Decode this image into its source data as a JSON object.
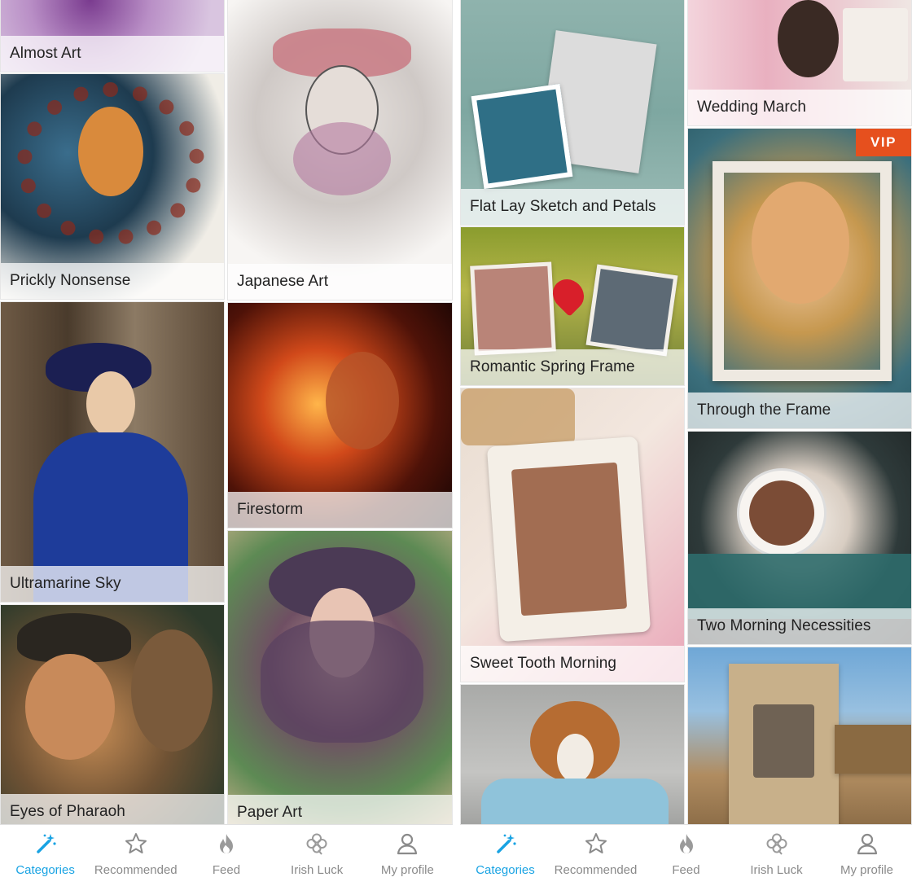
{
  "colors": {
    "accent": "#19a3e3",
    "vip_badge": "#e6501e",
    "nav_inactive": "#8a8a8a"
  },
  "left_screen": {
    "tiles": [
      {
        "label": "Almost Art"
      },
      {
        "label": "Prickly Nonsense"
      },
      {
        "label": "Ultramarine Sky"
      },
      {
        "label": "Eyes of Pharaoh"
      },
      {
        "label": "Japanese Art"
      },
      {
        "label": "Firestorm"
      },
      {
        "label": "Paper Art"
      }
    ],
    "nav": [
      {
        "label": "Categories",
        "icon": "magic-wand-icon",
        "active": true
      },
      {
        "label": "Recommended",
        "icon": "star-icon",
        "active": false
      },
      {
        "label": "Feed",
        "icon": "flame-icon",
        "active": false
      },
      {
        "label": "Irish Luck",
        "icon": "clover-icon",
        "active": false
      },
      {
        "label": "My profile",
        "icon": "person-icon",
        "active": false
      }
    ]
  },
  "right_screen": {
    "tiles": [
      {
        "label": "Flat Lay Sketch and Petals"
      },
      {
        "label": "Romantic Spring Frame"
      },
      {
        "label": "Sweet Tooth Morning"
      },
      {
        "label": ""
      },
      {
        "label": "Wedding March"
      },
      {
        "label": "Through the Frame",
        "badge": "VIP"
      },
      {
        "label": "Two Morning Necessities"
      },
      {
        "label": ""
      }
    ],
    "nav": [
      {
        "label": "Categories",
        "icon": "magic-wand-icon",
        "active": true
      },
      {
        "label": "Recommended",
        "icon": "star-icon",
        "active": false
      },
      {
        "label": "Feed",
        "icon": "flame-icon",
        "active": false
      },
      {
        "label": "Irish Luck",
        "icon": "clover-icon",
        "active": false
      },
      {
        "label": "My profile",
        "icon": "person-icon",
        "active": false
      }
    ]
  }
}
